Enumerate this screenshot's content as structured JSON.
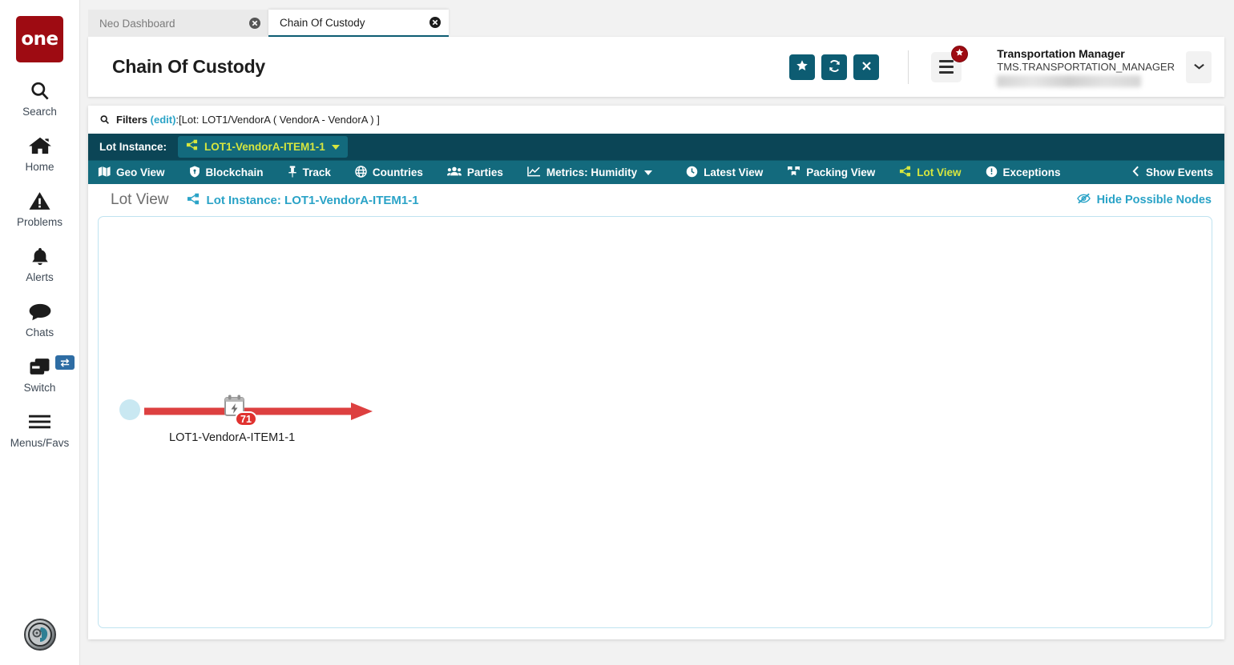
{
  "brand": {
    "logo_text": "one"
  },
  "rail": {
    "items": [
      {
        "label": "Search",
        "icon": "search-icon"
      },
      {
        "label": "Home",
        "icon": "home-icon"
      },
      {
        "label": "Problems",
        "icon": "warning-triangle-icon"
      },
      {
        "label": "Alerts",
        "icon": "bell-icon"
      },
      {
        "label": "Chats",
        "icon": "chat-bubble-icon"
      },
      {
        "label": "Switch",
        "icon": "windows-stack-icon",
        "badge_icon": "swap-arrows-icon"
      },
      {
        "label": "Menus/Favs",
        "icon": "hamburger-icon"
      }
    ],
    "avatar_icon": "assistant-avatar-icon"
  },
  "tabs": [
    {
      "title": "Neo Dashboard",
      "active": false
    },
    {
      "title": "Chain Of Custody",
      "active": true
    }
  ],
  "header": {
    "title": "Chain Of Custody",
    "buttons": [
      {
        "name": "favorite-button",
        "icon": "star-icon"
      },
      {
        "name": "refresh-button",
        "icon": "refresh-icon"
      },
      {
        "name": "close-button",
        "icon": "close-icon"
      }
    ],
    "menu_button_icon": "hamburger-icon",
    "menu_badge_icon": "star-icon",
    "user": {
      "role": "Transportation Manager",
      "login": "TMS.TRANSPORTATION_MANAGER",
      "caret_icon": "chevron-down-icon"
    }
  },
  "filters": {
    "icon": "search-icon",
    "label": "Filters",
    "edit_label": "(edit)",
    "separator": ":",
    "value": "[Lot: LOT1/VendorA ( VendorA - VendorA ) ]"
  },
  "lot_instance": {
    "label": "Lot Instance:",
    "chip_icon": "share-nodes-icon",
    "chip_value": "LOT1-VendorA-ITEM1-1",
    "chip_caret_icon": "caret-down-icon"
  },
  "nav_tabs": [
    {
      "label": "Geo View",
      "icon": "map-icon",
      "selected": false
    },
    {
      "label": "Blockchain",
      "icon": "shield-icon",
      "selected": false
    },
    {
      "label": "Track",
      "icon": "pin-icon",
      "selected": false
    },
    {
      "label": "Countries",
      "icon": "globe-icon",
      "selected": false
    },
    {
      "label": "Parties",
      "icon": "users-icon",
      "selected": false
    },
    {
      "label": "Metrics: Humidity",
      "icon": "chart-line-icon",
      "selected": false,
      "has_caret": true
    },
    {
      "label": "Latest View",
      "icon": "clock-icon",
      "selected": false
    },
    {
      "label": "Packing View",
      "icon": "boxes-icon",
      "selected": false
    },
    {
      "label": "Lot View",
      "icon": "share-nodes-icon",
      "selected": true
    },
    {
      "label": "Exceptions",
      "icon": "exclamation-circle-icon",
      "selected": false
    }
  ],
  "show_events": {
    "label": "Show Events",
    "icon": "chevron-left-icon"
  },
  "lot_view": {
    "title": "Lot View",
    "subtitle_icon": "share-nodes-icon",
    "subtitle": "Lot Instance: LOT1-VendorA-ITEM1-1",
    "hide_nodes_icon": "eye-slash-icon",
    "hide_nodes_label": "Hide Possible Nodes"
  },
  "graph": {
    "node_label": "LOT1-VendorA-ITEM1-1",
    "event_badge_count": "71",
    "event_icon": "calendar-bolt-icon",
    "edge_color": "#dd4040",
    "start_node_color": "#c9e8f2"
  },
  "colors": {
    "brand_red": "#9e0b12",
    "teal_dark": "#0b4556",
    "teal": "#136a7d",
    "accent_yellow": "#d6e63f",
    "link_blue": "#2aa3c7",
    "badge_red": "#e0322f"
  }
}
